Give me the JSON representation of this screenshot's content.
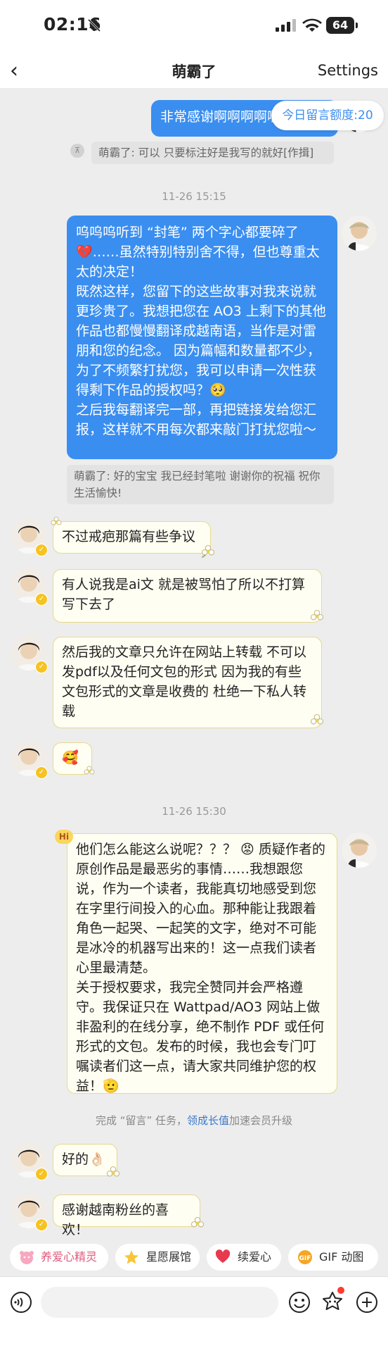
{
  "status": {
    "time": "02:16",
    "battery": "64"
  },
  "nav": {
    "back": "‹",
    "title": "萌霸了",
    "settings": "Settings"
  },
  "quota": "今日留言额度:20",
  "messages": {
    "m1": "非常感谢啊啊啊啊啊！",
    "q1": "萌霸了: 可以 只要标注好是我写的就好[作揖]",
    "t1": "11-26 15:15",
    "m2": "呜呜呜听到 “封笔” 两个字心都要碎了💔……虽然特别特别舍不得，但也尊重太太的决定！\n既然这样，您留下的这些故事对我来说就更珍贵了。我想把您在 AO3 上剩下的其他作品也都慢慢翻译成越南语，当作是对雷朋和您的纪念。 因为篇幅和数量都不少，为了不频繁打扰您，我可以申请一次性获得剩下作品的授权吗？🥺\n之后我每翻译完一部，再把链接发给您汇报，这样就不用每次都来敲门打扰您啦～",
    "q2": "萌霸了: 好的宝宝 我已经封笔啦 谢谢你的祝福 祝你生活愉快!",
    "m3": "不过戒疤那篇有些争议",
    "m4": "有人说我是ai文 就是被骂怕了所以不打算写下去了",
    "m5": "然后我的文章只允许在网站上转载 不可以发pdf以及任何文包的形式 因为我的有些文包形式的文章是收费的 杜绝一下私人转载",
    "m6": "🥰",
    "t2": "11-26 15:30",
    "m7": "他们怎么能这么说呢？？？ 😡 质疑作者的原创作品是最恶劣的事情……我想跟您说，作为一个读者，我能真切地感受到您在字里行间投入的心血。那种能让我跟着角色一起哭、一起笑的文字，绝对不可能是冰冷的机器写出来的！这一点我们读者心里最清楚。\n关于授权要求，我完全赞同并会严格遵守。我保证只在 Wattpad/AO3 网站上做非盈利的在线分享，绝不制作 PDF 或任何形式的文包。发布的时候，我也会专门叮嘱读者们这一点，请大家共同维护您的权益！🫡",
    "hi": "Hi",
    "m8": "好的👌🏻",
    "m9": "感谢越南粉丝的喜欢！"
  },
  "task": {
    "prefix": "完成 “留言” 任务，",
    "link": "领成长值",
    "suffix": "加速会员升级"
  },
  "chips": [
    "养爱心精灵",
    "星愿展馆",
    "续爱心",
    "GIF 动图"
  ],
  "colors": {
    "blue_bubble": "#3a8ef0",
    "yellow_border": "#e7d98c",
    "background": "#ededed"
  }
}
